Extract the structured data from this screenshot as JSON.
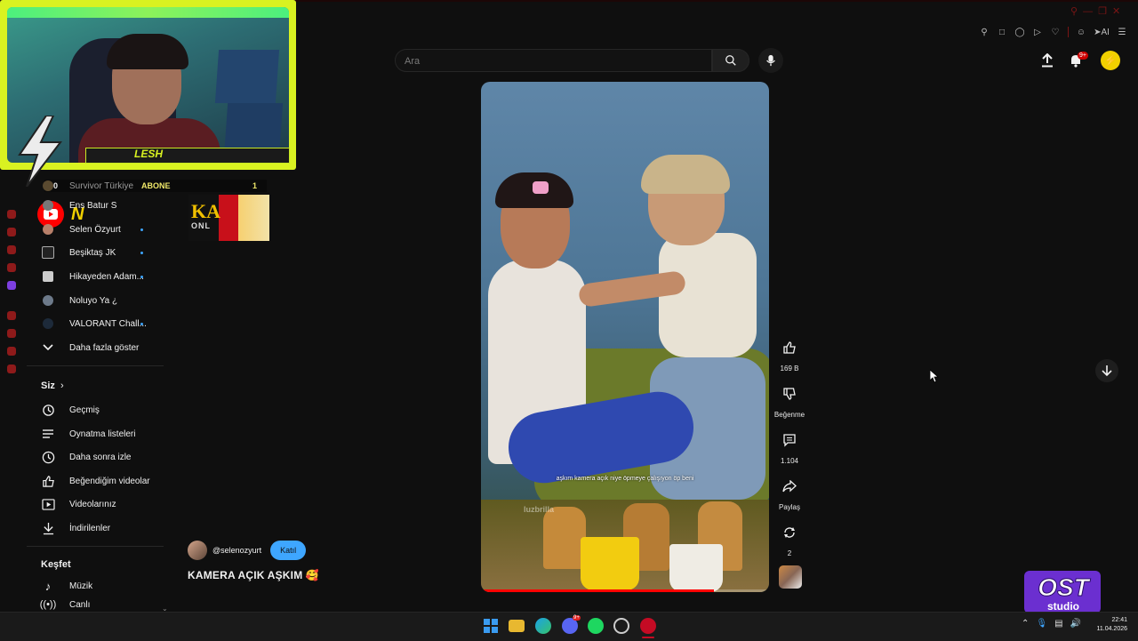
{
  "search": {
    "placeholder": "Ara"
  },
  "header": {
    "notification_badge": "9+"
  },
  "webcam": {
    "streamer_name": "LESH"
  },
  "overlay": {
    "abone_left": "0",
    "abone_label": "ABONE",
    "abone_right": "1",
    "sponsor_text": "KA",
    "sponsor_sub": "ONL"
  },
  "sidebar": {
    "subscriptions": [
      {
        "label": "Survivor Türkiye",
        "live": false
      },
      {
        "label": "Ens Batur S",
        "live": false
      },
      {
        "label": "Selen Özyurt",
        "live": true
      },
      {
        "label": "Beşiktaş JK",
        "live": true
      },
      {
        "label": "Hikayeden Adam...",
        "live": true
      },
      {
        "label": "Noluyo Ya ¿",
        "live": false
      },
      {
        "label": "VALORANT Chall...",
        "live": true
      }
    ],
    "show_more": "Daha fazla göster",
    "you_heading": "Siz",
    "you_items": [
      {
        "label": "Geçmiş",
        "icon": "history-icon"
      },
      {
        "label": "Oynatma listeleri",
        "icon": "playlist-icon"
      },
      {
        "label": "Daha sonra izle",
        "icon": "clock-icon"
      },
      {
        "label": "Beğendiğim videolar",
        "icon": "thumbs-up-icon"
      },
      {
        "label": "Videolarınız",
        "icon": "video-icon"
      },
      {
        "label": "İndirilenler",
        "icon": "download-icon"
      }
    ],
    "explore_heading": "Keşfet",
    "explore_items": [
      {
        "label": "Müzik",
        "icon": "music-icon"
      },
      {
        "label": "Canlı",
        "icon": "live-icon"
      }
    ]
  },
  "video": {
    "caption": "aşkım kamera açık niye öpmeye çalışıyon öp beni",
    "watermark": "luzbrilla",
    "progress": 0.81
  },
  "actions": {
    "likes": "169 B",
    "dislike_label": "Beğenme",
    "comments": "1.104",
    "share_label": "Paylaş",
    "remix_count": "2"
  },
  "channel": {
    "handle": "@selenozyurt",
    "join_label": "Katıl",
    "title": "KAMERA AÇIK AŞKIM 🥰"
  },
  "ost_logo": {
    "line1": "OST",
    "line2": "studio"
  },
  "taskbar": {
    "time": "22:41",
    "date": "11.04.2026",
    "discord_badge": "9+"
  },
  "colors": {
    "accent_red": "#ff0000",
    "link_blue": "#3ea6ff",
    "webcam_frame": "#d9f221",
    "background": "#0f0f0f"
  }
}
